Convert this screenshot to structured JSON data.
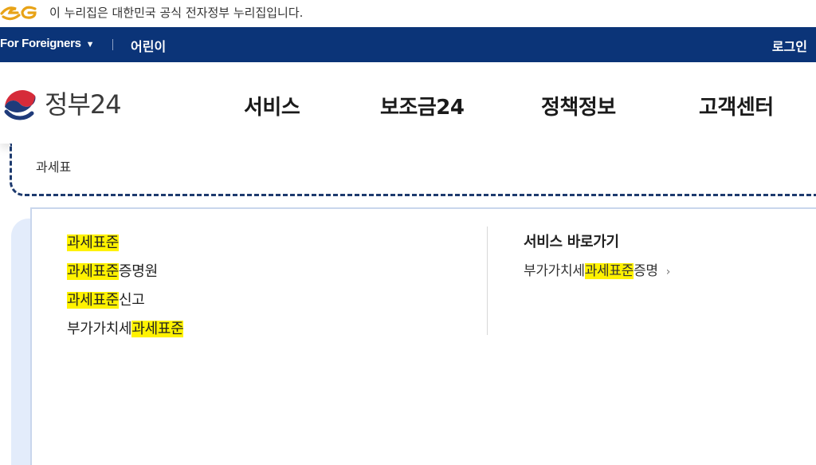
{
  "gov_banner": {
    "logo": "eG-logo",
    "text": "이 누리집은 대한민국 공식 전자정부 누리집입니다."
  },
  "util_bar": {
    "foreigners_label": "For Foreigners",
    "foreigners_caret": "▼",
    "kids_label": "어린이",
    "login_label": "로그인",
    "background_color": "#0b3478"
  },
  "header": {
    "brand_name": "정부24",
    "emblem": "taegeuk-emblem",
    "nav": [
      "서비스",
      "보조금24",
      "정책정보",
      "고객센터"
    ]
  },
  "search": {
    "value": "과세표"
  },
  "suggestions": [
    {
      "highlight": "과세표준",
      "rest": ""
    },
    {
      "highlight": "과세표준",
      "rest": "증명원"
    },
    {
      "highlight": "과세표준",
      "rest": "신고"
    },
    {
      "prefix": "부가가치세",
      "highlight": "과세표준",
      "rest": ""
    }
  ],
  "quick": {
    "title": "서비스 바로가기",
    "link_prefix": "부가가치세",
    "link_highlight": "과세표준",
    "link_rest": "증명",
    "chevron": "›"
  },
  "colors": {
    "highlight": "#fff200",
    "navy": "#0b3478"
  }
}
